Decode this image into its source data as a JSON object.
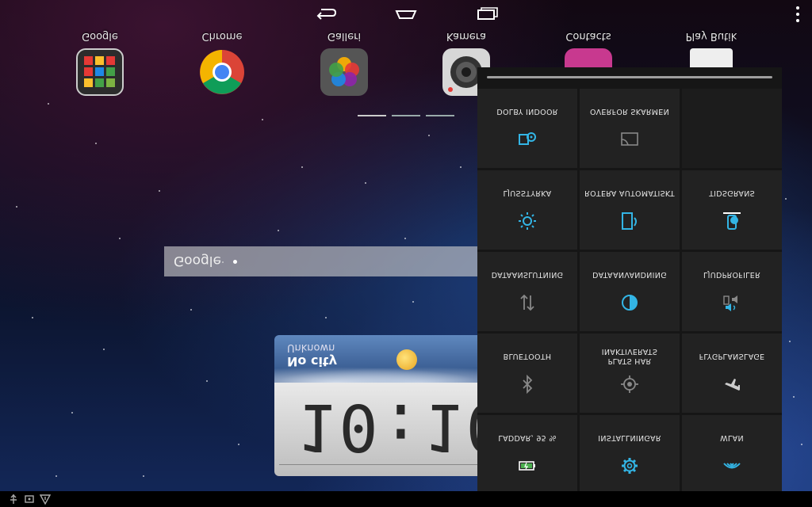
{
  "apps": [
    {
      "label": "Google"
    },
    {
      "label": "Chrome"
    },
    {
      "label": "Galleri"
    },
    {
      "label": "Kamera"
    },
    {
      "label": "Contacts"
    },
    {
      "label": "Play Butik"
    }
  ],
  "search": {
    "label": "Google"
  },
  "weather": {
    "city": "No city",
    "status": "Unknown",
    "time": "10:10"
  },
  "quick_settings": {
    "tiles": [
      {
        "label": "DOLBY INDOOR",
        "icon": "dolby-icon"
      },
      {
        "label": "ÖVERFÖR SKÄRMEN",
        "icon": "cast-screen-icon"
      },
      {
        "label": "LJUSSTYRKA",
        "icon": "brightness-icon"
      },
      {
        "label": "ROTERA AUTOMATISKT",
        "icon": "auto-rotate-icon"
      },
      {
        "label": "TIDSGRÄNS",
        "icon": "timeout-icon"
      },
      {
        "label": "DATAANSLUTNING",
        "icon": "data-arrows-icon"
      },
      {
        "label": "DATAANVÄNDNING",
        "icon": "data-usage-icon"
      },
      {
        "label": "LJUDPROFILER",
        "icon": "sound-profiles-icon"
      },
      {
        "label": "BLUETOOTH",
        "icon": "bluetooth-icon"
      },
      {
        "label": "PLATS HAR INAKTIVERATS",
        "icon": "location-icon"
      },
      {
        "label": "FLYGPLANSLÄGE",
        "icon": "airplane-icon"
      },
      {
        "label": "LADDAR, 95 %",
        "icon": "battery-icon"
      },
      {
        "label": "INSTÄLLNINGAR",
        "icon": "settings-gear-icon"
      },
      {
        "label": "WLAN",
        "icon": "wifi-icon"
      }
    ]
  },
  "colors": {
    "accent": "#33b5e5",
    "tile": "#222222",
    "panel": "#161616"
  }
}
